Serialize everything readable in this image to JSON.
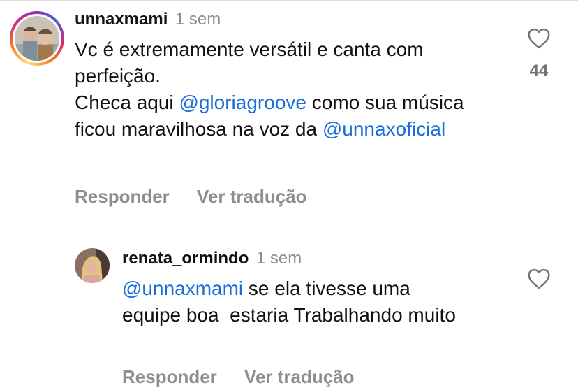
{
  "comments": [
    {
      "username": "unnaxmami",
      "time": "1 sem",
      "paragraphs": [
        [
          "Vc é extremamente versátil e canta com perfeição."
        ],
        [
          "Checa aqui ",
          "@gloriagroove",
          " como sua música ficou maravilhosa na voz da ",
          "@unnaxoficial"
        ]
      ],
      "like_icon": "heart-outline-icon",
      "like_count": "44",
      "reply_label": "Responder",
      "translate_label": "Ver tradução"
    },
    {
      "username": "renata_ormindo",
      "time": "1 sem",
      "paragraphs": [
        [
          "@unnaxmami",
          " se ela tivesse uma equipe boa  estaria Trabalhando muito"
        ]
      ],
      "like_icon": "heart-outline-icon",
      "reply_label": "Responder",
      "translate_label": "Ver tradução"
    }
  ],
  "colors": {
    "mention": "#1a6ed8",
    "muted": "#8e8e8e"
  }
}
